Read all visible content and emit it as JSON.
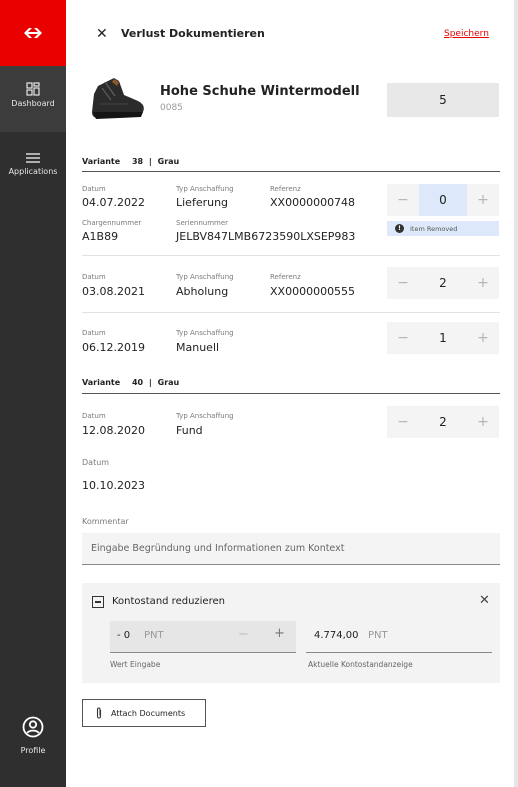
{
  "sidebar": {
    "items": [
      {
        "label": "Dashboard",
        "icon": "dashboard-icon"
      },
      {
        "label": "Applications",
        "icon": "menu-icon"
      }
    ],
    "profile_label": "Profile",
    "brand_color": "#eb0000"
  },
  "header": {
    "title": "Verlust Dokumentieren",
    "save_label": "Speichern"
  },
  "product": {
    "name": "Hohe Schuhe Wintermodell",
    "code": "0085",
    "quantity": "5"
  },
  "variants": [
    {
      "label": "Variante",
      "size": "38",
      "sep": "|",
      "color": "Grau",
      "entries": [
        {
          "datum_label": "Datum",
          "datum": "04.07.2022",
          "typ_label": "Typ Anschaffung",
          "typ": "Lieferung",
          "ref_label": "Referenz",
          "ref": "XX0000000748",
          "charge_label": "Chargennummer",
          "charge": "A1B89",
          "serien_label": "Seriennummer",
          "serien": "JELBV847LMB6723590LXSEP983",
          "qty": "0",
          "notice": "Item Removed"
        },
        {
          "datum_label": "Datum",
          "datum": "03.08.2021",
          "typ_label": "Typ Anschaffung",
          "typ": "Abholung",
          "ref_label": "Referenz",
          "ref": "XX0000000555",
          "qty": "2"
        },
        {
          "datum_label": "Datum",
          "datum": "06.12.2019",
          "typ_label": "Typ Anschaffung",
          "typ": "Manuell",
          "qty": "1"
        }
      ]
    },
    {
      "label": "Variante",
      "size": "40",
      "sep": "|",
      "color": "Grau",
      "entries": [
        {
          "datum_label": "Datum",
          "datum": "12.08.2020",
          "typ_label": "Typ Anschaffung",
          "typ": "Fund",
          "qty": "2"
        }
      ]
    }
  ],
  "stepper": {
    "minus": "−",
    "plus": "+"
  },
  "date_field": {
    "label": "Datum",
    "value": "10.10.2023"
  },
  "comment": {
    "label": "Kommentar",
    "placeholder": "Eingabe Begründung und Informationen zum Kontext"
  },
  "balance": {
    "title": "Kontostand reduzieren",
    "input_value": "- 0",
    "input_unit": "PNT",
    "input_label": "Wert Eingabe",
    "current_value": "4.774,00",
    "current_unit": "PNT",
    "current_label": "Aktuelle Kontostandanzeige"
  },
  "attach_label": "Attach Documents"
}
